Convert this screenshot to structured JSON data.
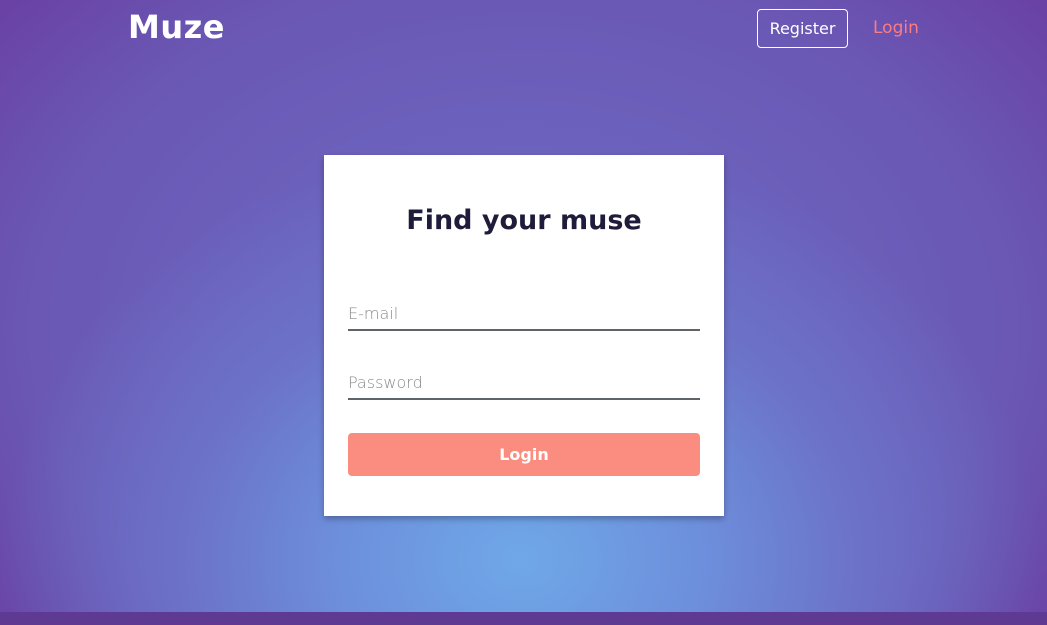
{
  "navbar": {
    "brand": "Muze",
    "register_label": "Register",
    "login_label": "Login"
  },
  "login_card": {
    "title": "Find your muse",
    "email_placeholder": "E-mail",
    "password_placeholder": "Password",
    "submit_label": "Login"
  },
  "colors": {
    "accent": "#fb8c80",
    "nav_login": "#fb7c84",
    "title": "#1e1c3a"
  }
}
